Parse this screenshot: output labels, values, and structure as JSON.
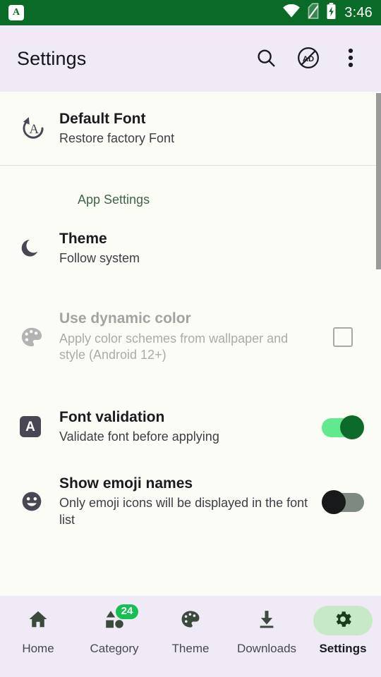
{
  "status_bar": {
    "app_icon_letter": "A",
    "icons": [
      "wifi-icon",
      "no-sim-icon",
      "battery-charging-icon"
    ],
    "time": "3:46",
    "background_color": "#0A6B29"
  },
  "app_bar": {
    "title": "Settings",
    "background_color": "#EFEAF5",
    "actions": [
      {
        "name": "search-icon",
        "label": "Search"
      },
      {
        "name": "ad-block-icon",
        "label": "AD"
      },
      {
        "name": "overflow-menu-icon",
        "label": "More options"
      }
    ]
  },
  "content": {
    "default_font": {
      "icon": "restore-font-icon",
      "title": "Default Font",
      "subtitle": "Restore factory Font"
    },
    "section_header": "App Settings",
    "items": [
      {
        "icon": "moon-icon",
        "title": "Theme",
        "subtitle": "Follow system",
        "control": "none",
        "enabled": true
      },
      {
        "icon": "palette-icon",
        "title": "Use dynamic color",
        "subtitle": "Apply color schemes from wallpaper and style (Android 12+)",
        "control": "checkbox",
        "checked": false,
        "enabled": false
      },
      {
        "icon": "letter-a-icon",
        "title": "Font validation",
        "subtitle": "Validate font before applying",
        "control": "switch",
        "checked": true,
        "enabled": true
      },
      {
        "icon": "emoji-smile-icon",
        "title": "Show emoji names",
        "subtitle": "Only emoji icons will be displayed in the font list",
        "control": "switch",
        "checked": false,
        "enabled": true
      }
    ]
  },
  "bottom_nav": {
    "background_color": "#EFEAF5",
    "active_index": 4,
    "active_pill_color": "#C8E9C8",
    "badge_color": "#15BF52",
    "items": [
      {
        "icon": "home-icon",
        "label": "Home",
        "badge": null
      },
      {
        "icon": "category-icon",
        "label": "Category",
        "badge": "24"
      },
      {
        "icon": "palette-icon",
        "label": "Theme",
        "badge": null
      },
      {
        "icon": "download-icon",
        "label": "Downloads",
        "badge": null
      },
      {
        "icon": "gear-icon",
        "label": "Settings",
        "badge": null
      }
    ]
  }
}
